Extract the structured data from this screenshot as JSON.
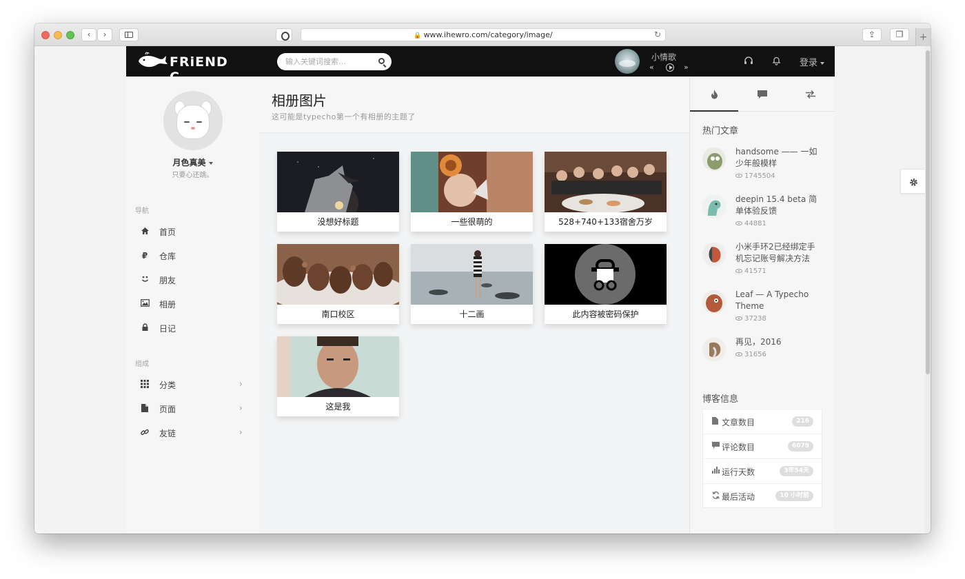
{
  "browser": {
    "url": "www.ihewro.com/category/image/"
  },
  "header": {
    "logo_text": "FRiEND C",
    "search_placeholder": "输入关键词搜索…",
    "music": {
      "song_title": "小情歌",
      "prev_glyph": "«",
      "next_glyph": "»"
    },
    "login_label": "登录"
  },
  "sidebar": {
    "user_name": "月色真美",
    "user_motto": "只要心还跳。",
    "nav_label": "导航",
    "nav_items": [
      {
        "label": "首页",
        "icon": "home-icon"
      },
      {
        "label": "仓库",
        "icon": "repository-icon"
      },
      {
        "label": "朋友",
        "icon": "friends-icon"
      },
      {
        "label": "相册",
        "icon": "image-icon"
      },
      {
        "label": "日记",
        "icon": "lock-icon"
      }
    ],
    "compose_label": "组成",
    "compose_items": [
      {
        "label": "分类",
        "icon": "grid-icon"
      },
      {
        "label": "页面",
        "icon": "file-icon"
      },
      {
        "label": "友链",
        "icon": "link-icon"
      }
    ]
  },
  "main": {
    "title": "相册图片",
    "subtitle": "这可能是typecho第一个有相册的主题了",
    "albums": [
      {
        "caption": "没想好标题"
      },
      {
        "caption": "一些很萌的"
      },
      {
        "caption": "528+740+133宿舍万岁"
      },
      {
        "caption": "南口校区"
      },
      {
        "caption": "十二画"
      },
      {
        "caption": "此内容被密码保护"
      },
      {
        "caption": "这是我"
      }
    ]
  },
  "right_sidebar": {
    "tabs": [
      {
        "icon": "fire-icon"
      },
      {
        "icon": "comment-icon"
      },
      {
        "icon": "exchange-icon"
      }
    ],
    "hot_title": "热门文章",
    "hot_posts": [
      {
        "title": "handsome —— 一如少年般模样",
        "views": "1745504"
      },
      {
        "title": "deepin 15.4 beta 简单体验反馈",
        "views": "44881"
      },
      {
        "title": "小米手环2已经绑定手机忘记账号解决方法",
        "views": "41571"
      },
      {
        "title": "Leaf — A Typecho Theme",
        "views": "37238"
      },
      {
        "title": "再见，2016",
        "views": "31656"
      }
    ],
    "info_title": "博客信息",
    "info_rows": [
      {
        "label": "文章数目",
        "value": "216",
        "icon": "file-icon"
      },
      {
        "label": "评论数目",
        "value": "6079",
        "icon": "comment-icon"
      },
      {
        "label": "运行天数",
        "value": "3年54天",
        "icon": "bar-chart-icon"
      },
      {
        "label": "最后活动",
        "value": "10 小时前",
        "icon": "refresh-icon"
      }
    ]
  }
}
